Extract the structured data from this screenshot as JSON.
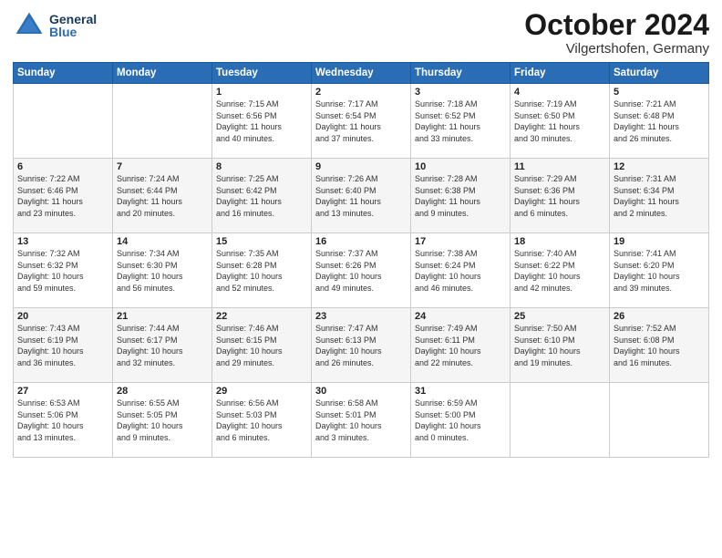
{
  "header": {
    "logo_general": "General",
    "logo_blue": "Blue",
    "month": "October 2024",
    "location": "Vilgertshofen, Germany"
  },
  "weekdays": [
    "Sunday",
    "Monday",
    "Tuesday",
    "Wednesday",
    "Thursday",
    "Friday",
    "Saturday"
  ],
  "weeks": [
    [
      {
        "day": "",
        "info": ""
      },
      {
        "day": "",
        "info": ""
      },
      {
        "day": "1",
        "info": "Sunrise: 7:15 AM\nSunset: 6:56 PM\nDaylight: 11 hours\nand 40 minutes."
      },
      {
        "day": "2",
        "info": "Sunrise: 7:17 AM\nSunset: 6:54 PM\nDaylight: 11 hours\nand 37 minutes."
      },
      {
        "day": "3",
        "info": "Sunrise: 7:18 AM\nSunset: 6:52 PM\nDaylight: 11 hours\nand 33 minutes."
      },
      {
        "day": "4",
        "info": "Sunrise: 7:19 AM\nSunset: 6:50 PM\nDaylight: 11 hours\nand 30 minutes."
      },
      {
        "day": "5",
        "info": "Sunrise: 7:21 AM\nSunset: 6:48 PM\nDaylight: 11 hours\nand 26 minutes."
      }
    ],
    [
      {
        "day": "6",
        "info": "Sunrise: 7:22 AM\nSunset: 6:46 PM\nDaylight: 11 hours\nand 23 minutes."
      },
      {
        "day": "7",
        "info": "Sunrise: 7:24 AM\nSunset: 6:44 PM\nDaylight: 11 hours\nand 20 minutes."
      },
      {
        "day": "8",
        "info": "Sunrise: 7:25 AM\nSunset: 6:42 PM\nDaylight: 11 hours\nand 16 minutes."
      },
      {
        "day": "9",
        "info": "Sunrise: 7:26 AM\nSunset: 6:40 PM\nDaylight: 11 hours\nand 13 minutes."
      },
      {
        "day": "10",
        "info": "Sunrise: 7:28 AM\nSunset: 6:38 PM\nDaylight: 11 hours\nand 9 minutes."
      },
      {
        "day": "11",
        "info": "Sunrise: 7:29 AM\nSunset: 6:36 PM\nDaylight: 11 hours\nand 6 minutes."
      },
      {
        "day": "12",
        "info": "Sunrise: 7:31 AM\nSunset: 6:34 PM\nDaylight: 11 hours\nand 2 minutes."
      }
    ],
    [
      {
        "day": "13",
        "info": "Sunrise: 7:32 AM\nSunset: 6:32 PM\nDaylight: 10 hours\nand 59 minutes."
      },
      {
        "day": "14",
        "info": "Sunrise: 7:34 AM\nSunset: 6:30 PM\nDaylight: 10 hours\nand 56 minutes."
      },
      {
        "day": "15",
        "info": "Sunrise: 7:35 AM\nSunset: 6:28 PM\nDaylight: 10 hours\nand 52 minutes."
      },
      {
        "day": "16",
        "info": "Sunrise: 7:37 AM\nSunset: 6:26 PM\nDaylight: 10 hours\nand 49 minutes."
      },
      {
        "day": "17",
        "info": "Sunrise: 7:38 AM\nSunset: 6:24 PM\nDaylight: 10 hours\nand 46 minutes."
      },
      {
        "day": "18",
        "info": "Sunrise: 7:40 AM\nSunset: 6:22 PM\nDaylight: 10 hours\nand 42 minutes."
      },
      {
        "day": "19",
        "info": "Sunrise: 7:41 AM\nSunset: 6:20 PM\nDaylight: 10 hours\nand 39 minutes."
      }
    ],
    [
      {
        "day": "20",
        "info": "Sunrise: 7:43 AM\nSunset: 6:19 PM\nDaylight: 10 hours\nand 36 minutes."
      },
      {
        "day": "21",
        "info": "Sunrise: 7:44 AM\nSunset: 6:17 PM\nDaylight: 10 hours\nand 32 minutes."
      },
      {
        "day": "22",
        "info": "Sunrise: 7:46 AM\nSunset: 6:15 PM\nDaylight: 10 hours\nand 29 minutes."
      },
      {
        "day": "23",
        "info": "Sunrise: 7:47 AM\nSunset: 6:13 PM\nDaylight: 10 hours\nand 26 minutes."
      },
      {
        "day": "24",
        "info": "Sunrise: 7:49 AM\nSunset: 6:11 PM\nDaylight: 10 hours\nand 22 minutes."
      },
      {
        "day": "25",
        "info": "Sunrise: 7:50 AM\nSunset: 6:10 PM\nDaylight: 10 hours\nand 19 minutes."
      },
      {
        "day": "26",
        "info": "Sunrise: 7:52 AM\nSunset: 6:08 PM\nDaylight: 10 hours\nand 16 minutes."
      }
    ],
    [
      {
        "day": "27",
        "info": "Sunrise: 6:53 AM\nSunset: 5:06 PM\nDaylight: 10 hours\nand 13 minutes."
      },
      {
        "day": "28",
        "info": "Sunrise: 6:55 AM\nSunset: 5:05 PM\nDaylight: 10 hours\nand 9 minutes."
      },
      {
        "day": "29",
        "info": "Sunrise: 6:56 AM\nSunset: 5:03 PM\nDaylight: 10 hours\nand 6 minutes."
      },
      {
        "day": "30",
        "info": "Sunrise: 6:58 AM\nSunset: 5:01 PM\nDaylight: 10 hours\nand 3 minutes."
      },
      {
        "day": "31",
        "info": "Sunrise: 6:59 AM\nSunset: 5:00 PM\nDaylight: 10 hours\nand 0 minutes."
      },
      {
        "day": "",
        "info": ""
      },
      {
        "day": "",
        "info": ""
      }
    ]
  ]
}
